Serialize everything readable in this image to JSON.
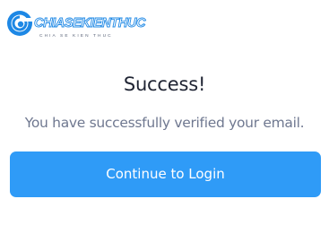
{
  "brand": {
    "logo_text": "CHIASEKIENTHUC",
    "logo_tagline": "CHIA SE KIEN THUC",
    "primary_color": "#2f9bf7"
  },
  "dialog": {
    "title": "Success!",
    "message": "You have successfully verified your email.",
    "button_label": "Continue to Login"
  }
}
